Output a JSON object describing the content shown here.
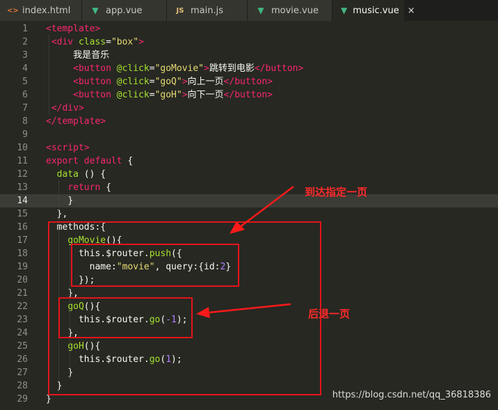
{
  "tabs": [
    {
      "label": "index.html",
      "icon": "html-file-icon",
      "glyph": "<>"
    },
    {
      "label": "app.vue",
      "icon": "vue-file-icon",
      "glyph": "▼"
    },
    {
      "label": "main.js",
      "icon": "js-file-icon",
      "glyph": "JS"
    },
    {
      "label": "movie.vue",
      "icon": "vue-file-icon",
      "glyph": "▼"
    },
    {
      "label": "music.vue",
      "icon": "vue-file-icon",
      "glyph": "▼",
      "active": true,
      "close": "×"
    }
  ],
  "lines": [
    {
      "n": "1",
      "tokens": [
        [
          "t-tag",
          "<"
        ],
        [
          "t-tag",
          "template"
        ],
        [
          "t-tag",
          ">"
        ]
      ],
      "indent": 0
    },
    {
      "n": "2",
      "tokens": [
        [
          "t-tag",
          "<div "
        ],
        [
          "t-attr",
          "class"
        ],
        [
          "t-br",
          "="
        ],
        [
          "t-str",
          "\"box\""
        ],
        [
          "t-tag",
          ">"
        ]
      ],
      "indent": 1
    },
    {
      "n": "3",
      "tokens": [
        [
          "t-cjk",
          "我是音乐"
        ]
      ],
      "indent": 5
    },
    {
      "n": "4",
      "tokens": [
        [
          "t-tag",
          "<button "
        ],
        [
          "t-attr",
          "@click"
        ],
        [
          "t-br",
          "="
        ],
        [
          "t-str",
          "\"goMovie\""
        ],
        [
          "t-tag",
          ">"
        ],
        [
          "t-cjk",
          "跳转到电影"
        ],
        [
          "t-tag",
          "</button>"
        ]
      ],
      "indent": 5
    },
    {
      "n": "5",
      "tokens": [
        [
          "t-tag",
          "<button "
        ],
        [
          "t-attr",
          "@click"
        ],
        [
          "t-br",
          "="
        ],
        [
          "t-str",
          "\"goQ\""
        ],
        [
          "t-tag",
          ">"
        ],
        [
          "t-cjk",
          "向上一页"
        ],
        [
          "t-tag",
          "</button>"
        ]
      ],
      "indent": 5
    },
    {
      "n": "6",
      "tokens": [
        [
          "t-tag",
          "<button "
        ],
        [
          "t-attr",
          "@click"
        ],
        [
          "t-br",
          "="
        ],
        [
          "t-str",
          "\"goH\""
        ],
        [
          "t-tag",
          ">"
        ],
        [
          "t-cjk",
          "向下一页"
        ],
        [
          "t-tag",
          "</button>"
        ]
      ],
      "indent": 5
    },
    {
      "n": "7",
      "tokens": [
        [
          "t-tag",
          "</div>"
        ]
      ],
      "indent": 1
    },
    {
      "n": "8",
      "tokens": [
        [
          "t-tag",
          "</template>"
        ]
      ],
      "indent": 0
    },
    {
      "n": "9",
      "tokens": [],
      "indent": 0
    },
    {
      "n": "10",
      "tokens": [
        [
          "t-tag",
          "<script>"
        ]
      ],
      "indent": 0
    },
    {
      "n": "11",
      "tokens": [
        [
          "t-kw",
          "export default "
        ],
        [
          "t-br",
          "{"
        ]
      ],
      "indent": 0
    },
    {
      "n": "12",
      "tokens": [
        [
          "t-fn",
          "data "
        ],
        [
          "t-br",
          "() {"
        ]
      ],
      "indent": 2
    },
    {
      "n": "13",
      "tokens": [
        [
          "t-kw",
          "return "
        ],
        [
          "t-br",
          "{"
        ]
      ],
      "indent": 4
    },
    {
      "n": "14",
      "tokens": [
        [
          "t-br",
          "}"
        ]
      ],
      "indent": 4,
      "current": true
    },
    {
      "n": "15",
      "tokens": [
        [
          "t-br",
          "},"
        ]
      ],
      "indent": 2
    },
    {
      "n": "16",
      "tokens": [
        [
          "t-prop",
          "methods"
        ],
        [
          "t-br",
          ":{"
        ]
      ],
      "indent": 2
    },
    {
      "n": "17",
      "tokens": [
        [
          "t-fn",
          "goMovie"
        ],
        [
          "t-br",
          "(){"
        ]
      ],
      "indent": 4
    },
    {
      "n": "18",
      "tokens": [
        [
          "t-prop",
          "this.$router."
        ],
        [
          "t-fn",
          "push"
        ],
        [
          "t-br",
          "({"
        ]
      ],
      "indent": 6
    },
    {
      "n": "19",
      "tokens": [
        [
          "t-prop",
          "name:"
        ],
        [
          "t-str",
          "\"movie\""
        ],
        [
          "t-prop",
          ", query:{id:"
        ],
        [
          "t-num",
          "2"
        ],
        [
          "t-prop",
          "}"
        ]
      ],
      "indent": 8
    },
    {
      "n": "20",
      "tokens": [
        [
          "t-br",
          "});"
        ]
      ],
      "indent": 6
    },
    {
      "n": "21",
      "tokens": [
        [
          "t-br",
          "},"
        ]
      ],
      "indent": 4
    },
    {
      "n": "22",
      "tokens": [
        [
          "t-fn",
          "goQ"
        ],
        [
          "t-br",
          "(){"
        ]
      ],
      "indent": 4
    },
    {
      "n": "23",
      "tokens": [
        [
          "t-prop",
          "this.$router."
        ],
        [
          "t-fn",
          "go"
        ],
        [
          "t-br",
          "("
        ],
        [
          "t-num",
          "-1"
        ],
        [
          "t-br",
          ");"
        ]
      ],
      "indent": 6
    },
    {
      "n": "24",
      "tokens": [
        [
          "t-br",
          "},"
        ]
      ],
      "indent": 4
    },
    {
      "n": "25",
      "tokens": [
        [
          "t-fn",
          "goH"
        ],
        [
          "t-br",
          "(){"
        ]
      ],
      "indent": 4
    },
    {
      "n": "26",
      "tokens": [
        [
          "t-prop",
          "this.$router."
        ],
        [
          "t-fn",
          "go"
        ],
        [
          "t-br",
          "("
        ],
        [
          "t-num",
          "1"
        ],
        [
          "t-br",
          ");"
        ]
      ],
      "indent": 6
    },
    {
      "n": "27",
      "tokens": [
        [
          "t-br",
          "}"
        ]
      ],
      "indent": 4
    },
    {
      "n": "28",
      "tokens": [
        [
          "t-br",
          "}"
        ]
      ],
      "indent": 2
    },
    {
      "n": "29",
      "tokens": [
        [
          "t-br",
          "}"
        ]
      ],
      "indent": 0
    }
  ],
  "annotations": {
    "arrival": "到达指定一页",
    "back": "后退一页"
  },
  "watermark": "https://blog.csdn.net/qq_36818386",
  "colors": {
    "highlight_box": "#e4141b",
    "background": "#272822"
  }
}
